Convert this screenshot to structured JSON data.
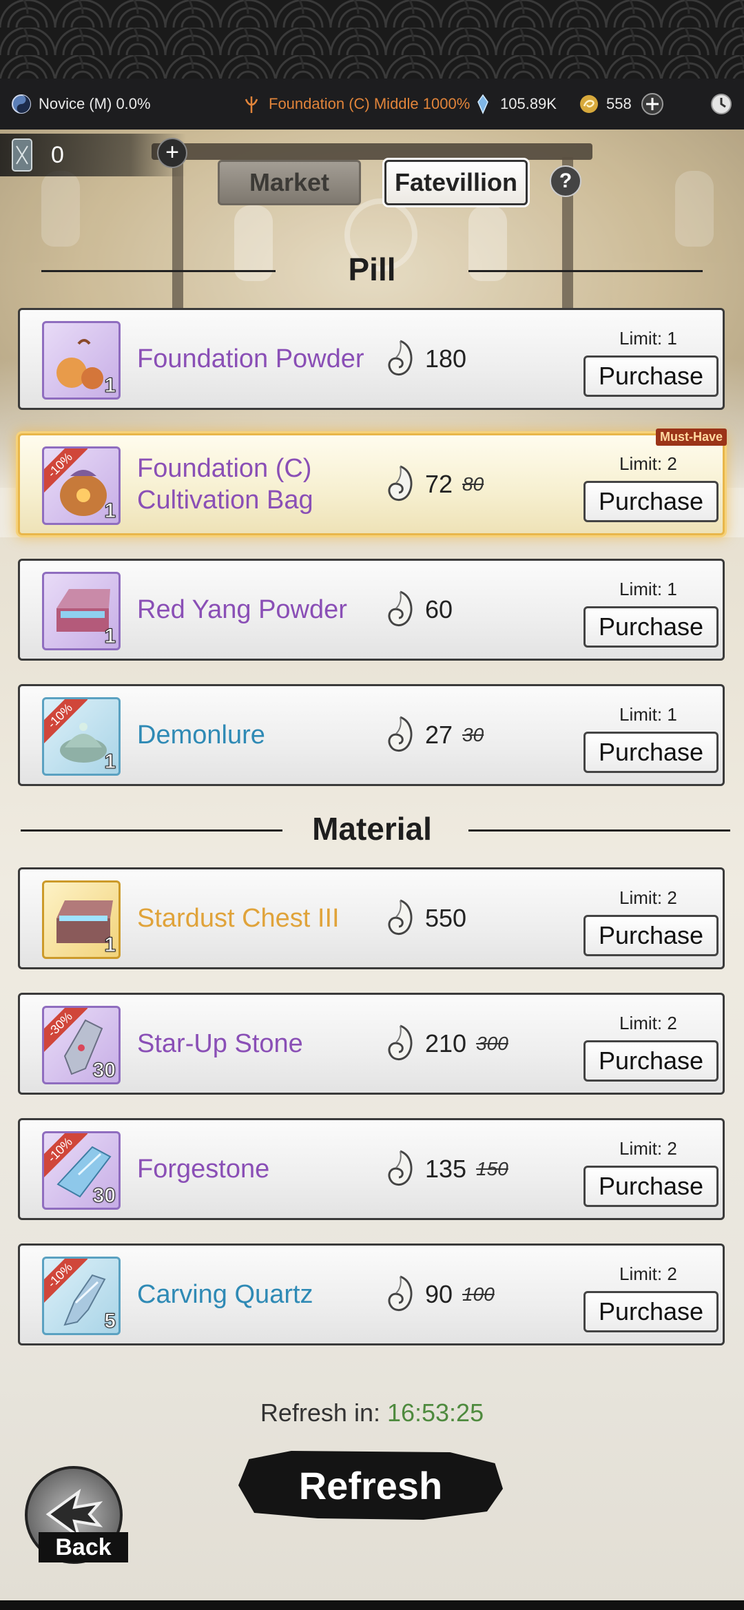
{
  "status_bar": {
    "rank": "Novice (M) 0.0%",
    "realm": "Foundation (C) Middle 1000%",
    "spirit_stones": "105.89K",
    "jade": "558"
  },
  "token": {
    "count": "0"
  },
  "tabs": [
    {
      "label": "Market",
      "active": false
    },
    {
      "label": "Fatevillion",
      "active": true
    }
  ],
  "help_label": "?",
  "sections": {
    "pill": "Pill",
    "material": "Material"
  },
  "pill_items": [
    {
      "name": "Foundation Powder",
      "qty": "1",
      "price": "180",
      "old_price": "",
      "discount": "",
      "limit": "Limit: 1",
      "button": "Purchase",
      "rarity": "purple"
    },
    {
      "name": "Foundation (C) Cultivation Bag",
      "qty": "1",
      "price": "72",
      "old_price": "80",
      "discount": "-10%",
      "limit": "Limit: 2",
      "button": "Purchase",
      "rarity": "purple",
      "badge": "Must-Have"
    },
    {
      "name": "Red Yang Powder",
      "qty": "1",
      "price": "60",
      "old_price": "",
      "discount": "",
      "limit": "Limit: 1",
      "button": "Purchase",
      "rarity": "purple"
    },
    {
      "name": "Demonlure",
      "qty": "1",
      "price": "27",
      "old_price": "30",
      "discount": "-10%",
      "limit": "Limit: 1",
      "button": "Purchase",
      "rarity": "blue"
    }
  ],
  "material_items": [
    {
      "name": "Stardust Chest III",
      "qty": "1",
      "price": "550",
      "old_price": "",
      "discount": "",
      "limit": "Limit: 2",
      "button": "Purchase",
      "rarity": "gold"
    },
    {
      "name": "Star-Up Stone",
      "qty": "30",
      "price": "210",
      "old_price": "300",
      "discount": "-30%",
      "limit": "Limit: 2",
      "button": "Purchase",
      "rarity": "purple"
    },
    {
      "name": "Forgestone",
      "qty": "30",
      "price": "135",
      "old_price": "150",
      "discount": "-10%",
      "limit": "Limit: 2",
      "button": "Purchase",
      "rarity": "purple"
    },
    {
      "name": "Carving Quartz",
      "qty": "5",
      "price": "90",
      "old_price": "100",
      "discount": "-10%",
      "limit": "Limit: 2",
      "button": "Purchase",
      "rarity": "blue"
    }
  ],
  "footer": {
    "refresh_prefix": "Refresh in: ",
    "refresh_time": "16:53:25",
    "refresh_button": "Refresh",
    "back_button": "Back"
  },
  "colors": {
    "name_purple": "#8a4fb6",
    "name_blue": "#2f8ab5",
    "name_gold": "#e0a33a",
    "timer_green": "#4e8a3e",
    "must_have_badge": "#9b3418"
  }
}
